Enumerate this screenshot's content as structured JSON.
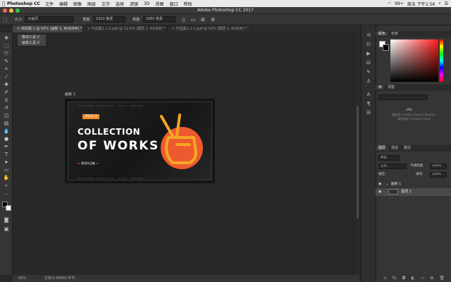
{
  "menubar": {
    "app": "Photoshop CC",
    "items": [
      "文件",
      "编辑",
      "图像",
      "图层",
      "文字",
      "选择",
      "滤镜",
      "3D",
      "视图",
      "窗口",
      "帮助"
    ],
    "battery": "99+",
    "clock": "周五 下午2:56"
  },
  "window": {
    "title": "Adobe Photoshop CC 2017"
  },
  "options": {
    "size_label": "大小:",
    "size_value": "大画页",
    "width_label": "宽度:",
    "width_value": "1920 像素",
    "height_label": "高度:",
    "height_value": "1080 像素"
  },
  "tabs": [
    {
      "label": "未标题-1 @ 50% (画板 1, RGB/8#) *"
    },
    {
      "label": "作品集1.1-1.pdf @ 12.5% (图层 1, RGB/8) *"
    },
    {
      "label": "作品集1.1-1.pdf @ 50% (图层 1, RGB/8) *"
    }
  ],
  "tooltip": {
    "item1": "移动工具",
    "key1": "V",
    "item2": "画板工具",
    "key2": "V"
  },
  "artboard": {
    "label": "画板 1",
    "year": "2022.1",
    "title1": "COLLECTION",
    "title2": "OF WORKS",
    "subtitle": "原创作品集",
    "deco": "DESIGNER PORTFOLIO · 2022 · DESIGN"
  },
  "status": {
    "zoom": "50%",
    "doc": "文档:5.93M/0 字节"
  },
  "panels": {
    "color_tabs": [
      "颜色",
      "色板"
    ],
    "library_tabs": [
      "库",
      "调整"
    ],
    "cc_text1": "要使用 Creative Cloud Libraries,",
    "cc_text2": "请登录到 Creative Cloud",
    "layer_tabs": [
      "图层",
      "通道",
      "路径"
    ],
    "kind": "类型",
    "blend": "正常",
    "opacity_label": "不透明度:",
    "opacity": "100%",
    "lock_label": "锁定:",
    "fill_label": "填充:",
    "fill": "100%",
    "layers": [
      {
        "name": "画板 1"
      },
      {
        "name": "图层 1"
      }
    ]
  }
}
